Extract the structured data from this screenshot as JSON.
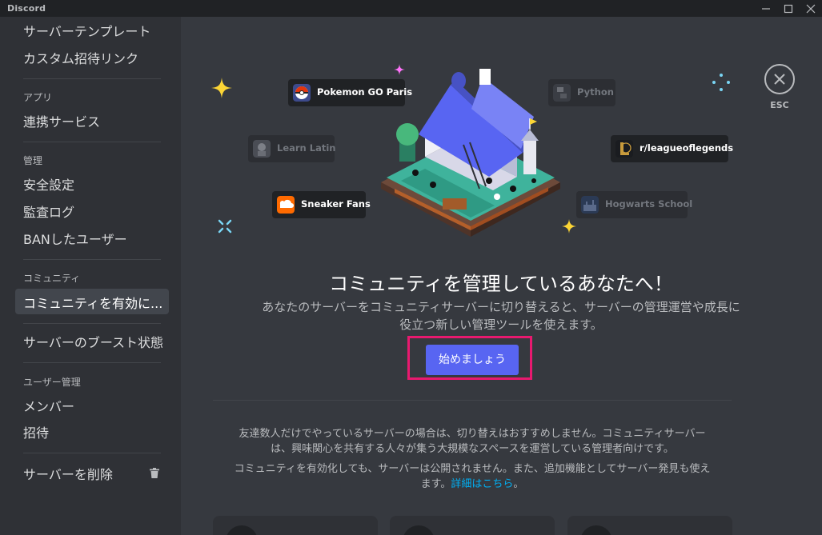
{
  "window": {
    "title": "Discord"
  },
  "sidebar": {
    "top_items": [
      {
        "label": "サーバーテンプレート"
      },
      {
        "label": "カスタム招待リンク"
      }
    ],
    "sections": [
      {
        "header": "アプリ",
        "items": [
          {
            "label": "連携サービス"
          }
        ]
      },
      {
        "header": "管理",
        "items": [
          {
            "label": "安全設定"
          },
          {
            "label": "監査ログ"
          },
          {
            "label": "BANしたユーザー"
          }
        ]
      },
      {
        "header": "コミュニティ",
        "items": [
          {
            "label": "コミュニティを有効に...",
            "active": true
          }
        ]
      },
      {
        "header": "",
        "items": [
          {
            "label": "サーバーのブースト状態"
          }
        ]
      },
      {
        "header": "ユーザー管理",
        "items": [
          {
            "label": "メンバー"
          },
          {
            "label": "招待"
          }
        ]
      }
    ],
    "delete_item": {
      "label": "サーバーを削除",
      "icon": "trash-icon"
    }
  },
  "close": {
    "label": "ESC",
    "icon": "close-icon"
  },
  "server_chips": [
    {
      "name": "Pokemon GO Paris",
      "icon": "pokeball-icon",
      "dim": false
    },
    {
      "name": "Python",
      "icon": "python-icon",
      "dim": true
    },
    {
      "name": "Learn Latin",
      "icon": "statue-icon",
      "dim": true
    },
    {
      "name": "r/leagueoflegends",
      "icon": "league-icon",
      "dim": false
    },
    {
      "name": "Sneaker Fans",
      "icon": "soundcloud-icon",
      "dim": false
    },
    {
      "name": "Hogwarts School",
      "icon": "castle-icon",
      "dim": true
    }
  ],
  "main": {
    "headline": "コミュニティを管理しているあなたへ！",
    "description_line1": "あなたのサーバーをコミュニティサーバーに切り替えると、サーバーの管理運営や成長に",
    "description_line2": "役立つ新しい管理ツールを使えます。",
    "cta_label": "始めましょう",
    "note1_line1": "友達数人だけでやっているサーバーの場合は、切り替えはおすすめしません。コミュニティサーバー",
    "note1_line2": "は、興味関心を共有する人々が集う大規模なスペースを運営している管理者向けです。",
    "note2_line1": "コミュニティを有効化しても、サーバーは公開されません。また、追加機能としてサーバー発見も使え",
    "note2_line2_prefix": "ます。",
    "note2_link": "詳細はこちら",
    "note2_suffix": "。"
  },
  "colors": {
    "accent": "#5865f2",
    "highlight": "#e8196f",
    "link": "#00b0f4",
    "sparkle_yellow": "#fcd535",
    "sparkle_pink": "#ff73fa"
  }
}
